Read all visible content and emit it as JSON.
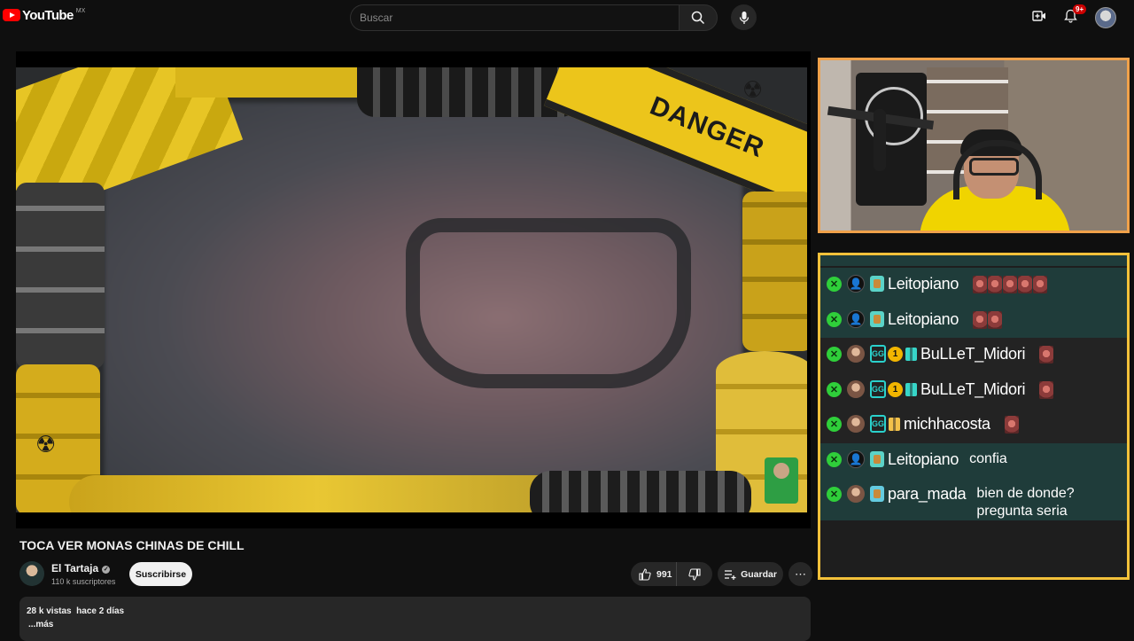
{
  "header": {
    "brand": "YouTube",
    "region": "MX",
    "search_placeholder": "Buscar",
    "notifications_badge": "9+"
  },
  "video": {
    "danger_text": "DANGER",
    "title": "TOCA VER MONAS CHINAS DE CHILL",
    "channel_name": "El Tartaja",
    "subscribers": "110 k suscriptores",
    "subscribe_label": "Suscribirse",
    "likes": "991",
    "save_label": "Guardar",
    "views": "28 k vistas",
    "published": "hace 2 días",
    "more_label": "...más"
  },
  "chat": {
    "messages": [
      {
        "user": "Leitopiano",
        "text": "",
        "emotes": 5,
        "style": "teal",
        "avatar": "default",
        "badges": [
          "sub"
        ]
      },
      {
        "user": "Leitopiano",
        "text": "",
        "emotes": 2,
        "style": "teal",
        "avatar": "default",
        "badges": [
          "sub"
        ]
      },
      {
        "user": "BuLLeT_Midori",
        "text": "",
        "emotes": 1,
        "style": "dark",
        "avatar": "img",
        "badges": [
          "gg",
          "bits",
          "gift"
        ]
      },
      {
        "user": "BuLLeT_Midori",
        "text": "",
        "emotes": 1,
        "style": "dark",
        "avatar": "img",
        "badges": [
          "gg",
          "bits",
          "gift"
        ]
      },
      {
        "user": "michhacosta",
        "text": "",
        "emotes": 1,
        "style": "dark",
        "avatar": "img",
        "badges": [
          "gg",
          "gift-gold"
        ]
      },
      {
        "user": "Leitopiano",
        "text": "confia",
        "emotes": 0,
        "style": "teal",
        "avatar": "default",
        "badges": [
          "sub"
        ]
      },
      {
        "user": "para_mada",
        "text": "bien de donde?\npregunta seria",
        "emotes": 0,
        "style": "teal",
        "avatar": "img",
        "badges": [
          "sub-pic"
        ]
      }
    ]
  },
  "colors": {
    "webcam_border": "#f0a14a",
    "chat_border": "#f3c13a",
    "mod_badge": "#2fcf3a",
    "brand_red": "#ff0000"
  }
}
